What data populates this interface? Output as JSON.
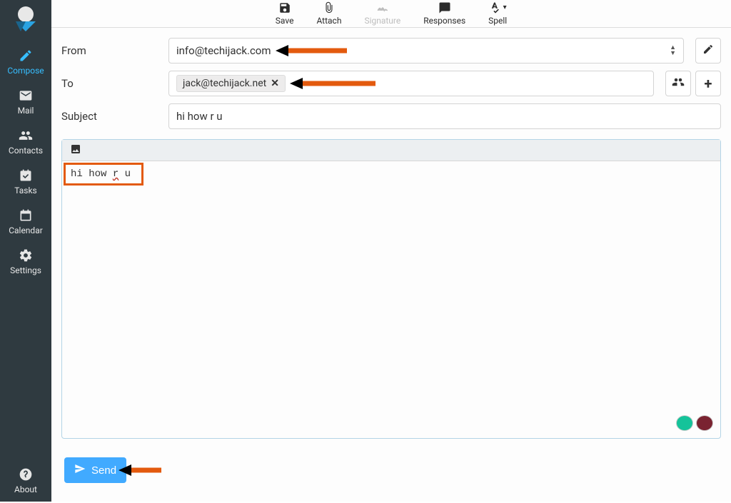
{
  "sidebar": {
    "items": [
      {
        "label": "Compose",
        "active": true
      },
      {
        "label": "Mail"
      },
      {
        "label": "Contacts"
      },
      {
        "label": "Tasks"
      },
      {
        "label": "Calendar"
      },
      {
        "label": "Settings"
      }
    ],
    "about_label": "About"
  },
  "toolbar": {
    "save_label": "Save",
    "attach_label": "Attach",
    "signature_label": "Signature",
    "responses_label": "Responses",
    "spell_label": "Spell"
  },
  "compose": {
    "from_label": "From",
    "from_value": "info@techijack.com",
    "to_label": "To",
    "to_chip": "jack@techijack.net",
    "subject_label": "Subject",
    "subject_value": "hi how r u",
    "body_words": [
      "hi",
      "how",
      "r",
      "u"
    ],
    "send_label": "Send"
  },
  "colors": {
    "sidebar_bg": "#2f3a40",
    "accent": "#37beff",
    "send_btn": "#41aaff",
    "annotation": "#e35a0e"
  }
}
